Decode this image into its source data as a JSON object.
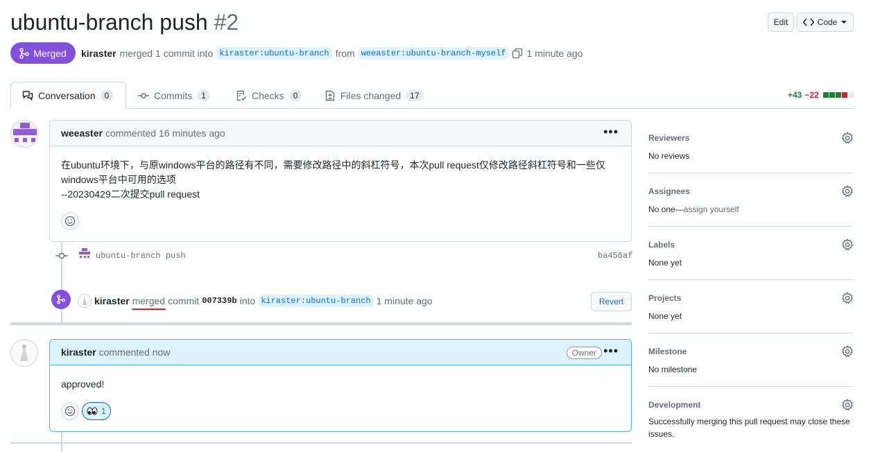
{
  "header": {
    "title": "ubuntu-branch push",
    "number": "#2",
    "edit_label": "Edit",
    "code_label": "Code",
    "state_label": "Merged",
    "author": "kiraster",
    "merged_text": "merged 1 commit into",
    "base_branch": "kiraster:ubuntu-branch",
    "from_text": "from",
    "head_branch": "weeaster:ubuntu-branch-myself",
    "time": "1 minute ago"
  },
  "tabs": [
    {
      "label": "Conversation",
      "count": "0"
    },
    {
      "label": "Commits",
      "count": "1"
    },
    {
      "label": "Checks",
      "count": "0"
    },
    {
      "label": "Files changed",
      "count": "17"
    }
  ],
  "diffstat": {
    "additions": "+43",
    "deletions": "−22"
  },
  "comment1": {
    "author": "weeaster",
    "meta": "commented 16 minutes ago",
    "line1": "在ubuntu环境下，与原windows平台的路径有不同，需要修改路径中的斜杠符号，本次pull request仅修改路径斜杠符号和一些仅",
    "line2": "windows平台中可用的选项",
    "line3": "--20230429二次提交pull request"
  },
  "commit": {
    "message": "ubuntu-branch push",
    "sha": "ba456af"
  },
  "merge_event": {
    "author": "kiraster",
    "action": "merged",
    "commit_word": "commit",
    "sha": "007339b",
    "into": "into",
    "branch": "kiraster:ubuntu-branch",
    "time": "1 minute ago",
    "revert_label": "Revert"
  },
  "comment2": {
    "author": "kiraster",
    "meta": "commented now",
    "owner_label": "Owner",
    "body": "approved!",
    "reaction_count": "1"
  },
  "sidebar": {
    "reviewers": {
      "title": "Reviewers",
      "value": "No reviews"
    },
    "assignees": {
      "title": "Assignees",
      "value": "No one—",
      "link": "assign yourself"
    },
    "labels": {
      "title": "Labels",
      "value": "None yet"
    },
    "projects": {
      "title": "Projects",
      "value": "None yet"
    },
    "milestone": {
      "title": "Milestone",
      "value": "No milestone"
    },
    "development": {
      "title": "Development",
      "value": "Successfully merging this pull request may close these issues."
    }
  },
  "colors": {
    "merged": "#8250df",
    "link": "#0969da",
    "annotation": "#d1242f"
  }
}
